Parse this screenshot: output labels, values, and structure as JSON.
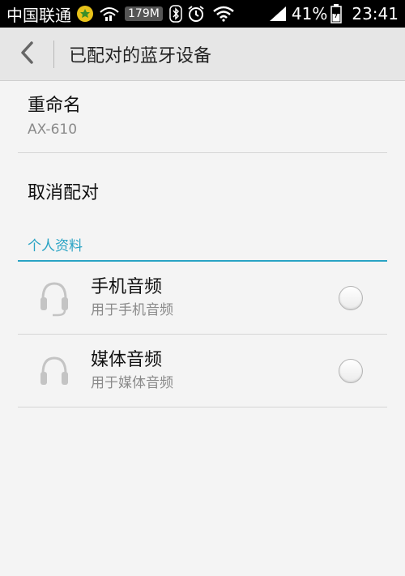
{
  "status_bar": {
    "carrier": "中国联通",
    "speed": "179M",
    "battery_percent": "41%",
    "time": "23:41",
    "icons": [
      "app-badge-icon",
      "wifi-bars-icon",
      "bluetooth-icon",
      "alarm-icon",
      "wifi-icon",
      "signal-icon",
      "battery-icon"
    ]
  },
  "action_bar": {
    "title": "已配对的蓝牙设备",
    "back_icon": "chevron-left-icon"
  },
  "rename": {
    "title": "重命名",
    "device_name": "AX-610"
  },
  "unpair": {
    "title": "取消配对"
  },
  "profiles_section": {
    "header": "个人资料",
    "accent_color": "#29a3c4",
    "items": [
      {
        "title": "手机音频",
        "subtitle": "用于手机音频",
        "icon": "headset-icon",
        "checked": false
      },
      {
        "title": "媒体音频",
        "subtitle": "用于媒体音频",
        "icon": "headphones-icon",
        "checked": false
      }
    ]
  }
}
